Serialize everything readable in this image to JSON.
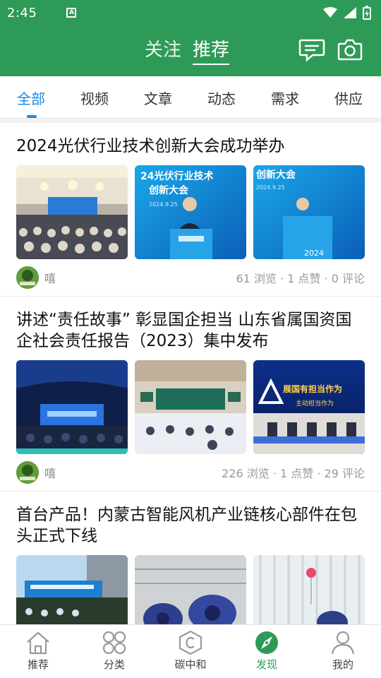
{
  "status": {
    "time": "2:45",
    "a_badge": "A"
  },
  "header": {
    "tabs": [
      {
        "label": "关注",
        "active": false
      },
      {
        "label": "推荐",
        "active": true
      }
    ]
  },
  "categories": [
    "全部",
    "视频",
    "文章",
    "动态",
    "需求",
    "供应"
  ],
  "active_category": "全部",
  "feed": [
    {
      "title": "2024光伏行业技术创新大会成功举办",
      "author": "嘻",
      "stats": "61 浏览 · 1 点赞 · 0 评论",
      "images": [
        {
          "desc": "conference hall audience"
        },
        {
          "banner_line1": "24光伏行业技术",
          "banner_line2": "创新大会",
          "date": "2024.9.25"
        },
        {
          "banner_line1": "创新大会",
          "date": "2024.9.25",
          "year": "2024"
        }
      ]
    },
    {
      "title": "讲述“责任故事” 彰显国企担当 山东省属国资国企社会责任报告（2023）集中发布",
      "author": "嘻",
      "stats": "226 浏览 · 1 点赞 · 29 评论",
      "images": [
        {
          "desc": "stage with blue screen"
        },
        {
          "desc": "ornate hall with audience"
        },
        {
          "banner_line1": "展国有担当作为",
          "banner_line2": "主动担当作为"
        }
      ]
    },
    {
      "title": "首台产品！内蒙古智能风机产业链核心部件在包头正式下线",
      "author": "",
      "stats": "",
      "images": [
        {
          "desc": "outdoor stage"
        },
        {
          "desc": "factory machinery"
        },
        {
          "desc": "factory interior with balloons"
        }
      ]
    }
  ],
  "bottom_tabs": [
    {
      "label": "推荐",
      "icon": "home-icon",
      "active": false
    },
    {
      "label": "分类",
      "icon": "grid-icon",
      "active": false
    },
    {
      "label": "碳中和",
      "icon": "carbon-icon",
      "active": false
    },
    {
      "label": "发现",
      "icon": "compass-icon",
      "active": true
    },
    {
      "label": "我的",
      "icon": "user-icon",
      "active": false
    }
  ],
  "colors": {
    "brand_green": "#2e9a57",
    "active_blue": "#1e88e5"
  }
}
